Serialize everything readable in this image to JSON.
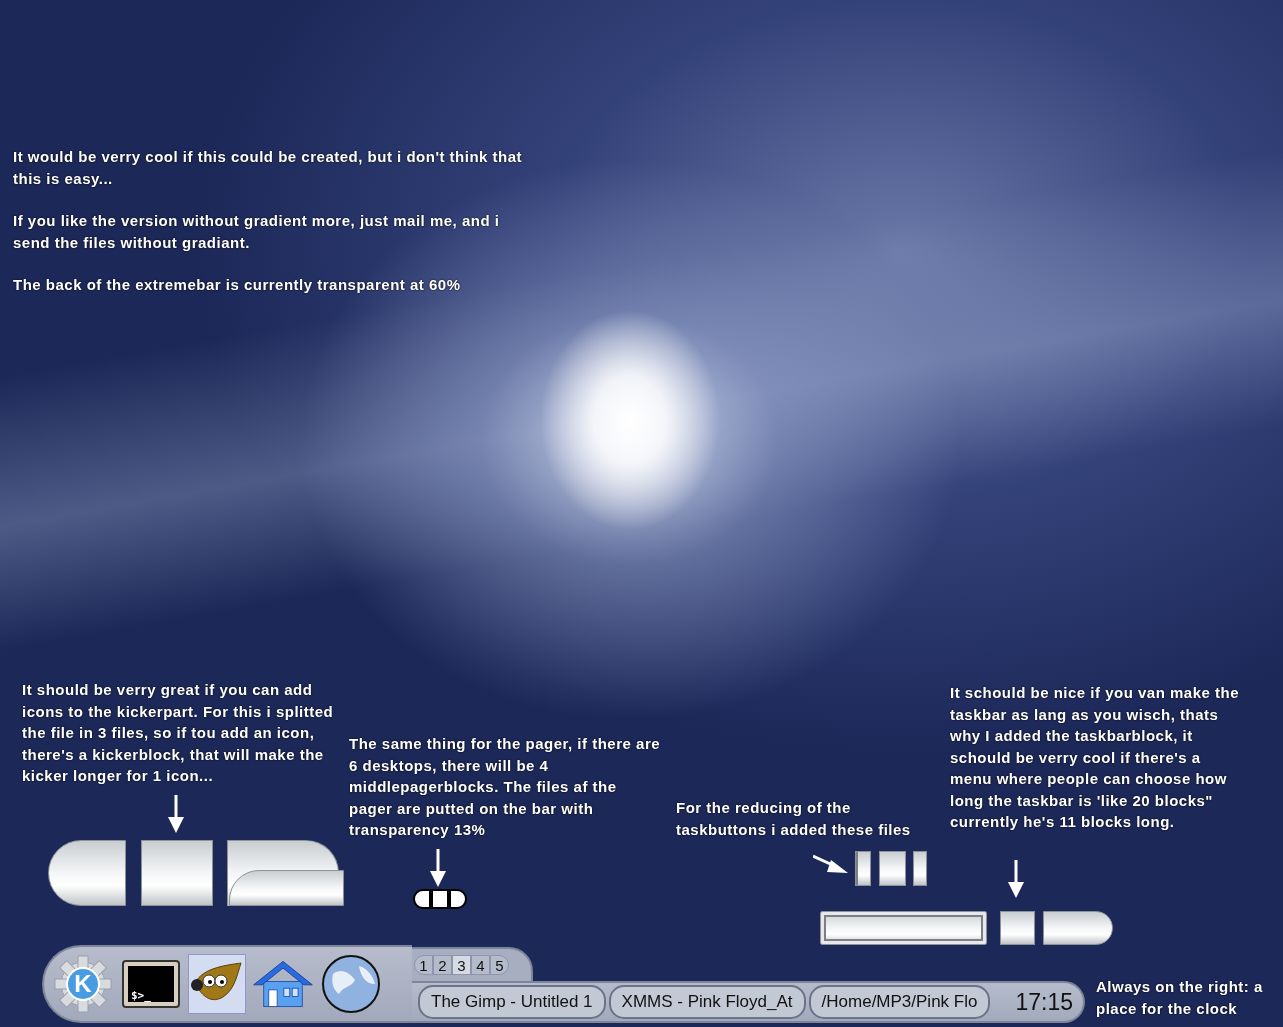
{
  "top_note": [
    "It would be verry cool if this could be created, but i don't think that this is easy...",
    "If you like the version without gradient more, just mail me, and i send the files without gradiant.",
    "The back of the extremebar is currently transparent at 60%"
  ],
  "notes": [
    {
      "kind": "kicker",
      "text": "It should be verry great if you can add icons to the kickerpart. For this i splitted the file in 3 files, so if tou add an icon, there's a kickerblock, that will make the kicker longer for 1 icon..."
    },
    {
      "kind": "pager",
      "text": "The same thing for the pager, if there are 6 desktops, there will be 4 middlepagerblocks. The files af the pager are putted on the bar with transparency 13%"
    },
    {
      "kind": "taskbuttons",
      "text": "For the reducing of the taskbuttons i added these files"
    },
    {
      "kind": "taskbar",
      "text": "It schould be nice if you van make the taskbar as lang as you wisch, thats why I added the taskbarblock, it schould be verry cool if there's a menu where people can choose how long the taskbar is 'like 20 blocks\" currently he's 11 blocks long."
    },
    {
      "kind": "clock",
      "text": "Always on the right: a place for the clock"
    }
  ],
  "panel": {
    "launchers": [
      {
        "kind": "kde",
        "label": "K",
        "highlighted": false
      },
      {
        "kind": "terminal",
        "label": "$>_",
        "highlighted": false
      },
      {
        "kind": "gimp",
        "highlighted": true
      },
      {
        "kind": "home",
        "highlighted": false
      },
      {
        "kind": "globe",
        "highlighted": false
      }
    ],
    "pager": [
      {
        "label": "1",
        "selected": false
      },
      {
        "label": "2",
        "selected": false
      },
      {
        "label": "3",
        "selected": true
      },
      {
        "label": "4",
        "selected": false
      },
      {
        "label": "5",
        "selected": false
      }
    ],
    "tasks": [
      "The Gimp - Untitled 1",
      "XMMS - Pink Floyd_At",
      "/Home/MP3/Pink Flo"
    ],
    "clock": "17:15"
  }
}
